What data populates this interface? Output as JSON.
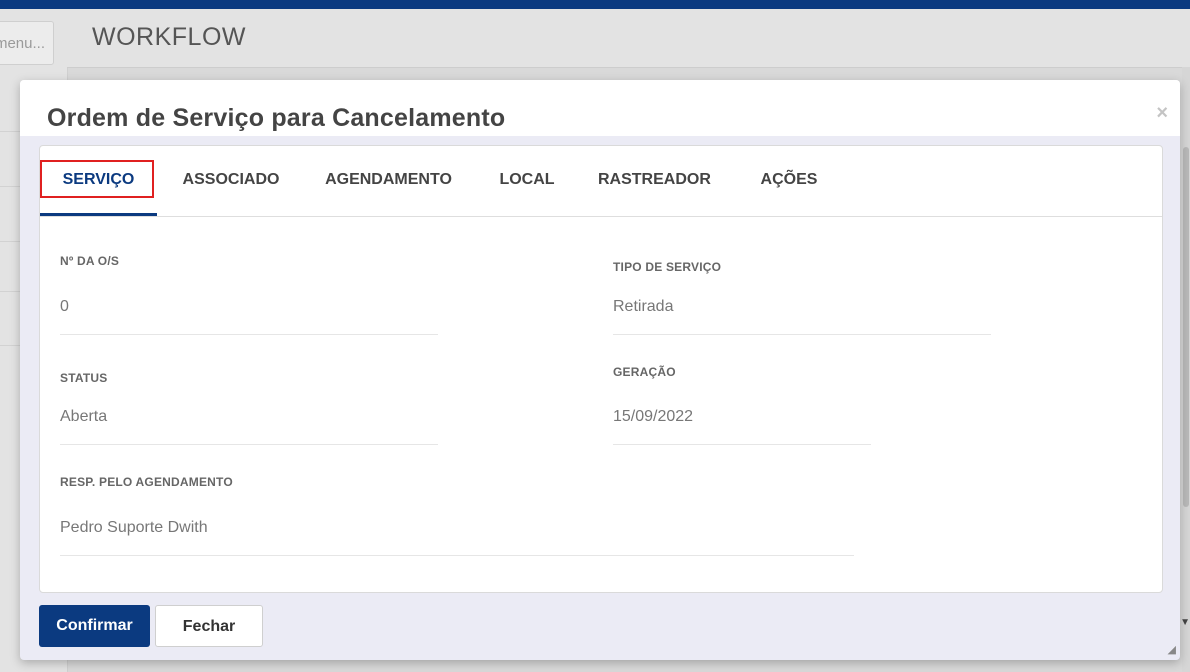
{
  "app": {
    "side_search_placeholder": "menu...",
    "page_title": "WORKFLOW"
  },
  "modal": {
    "title": "Ordem de Serviço para Cancelamento",
    "close_symbol": "×",
    "tabs": [
      {
        "label": "SERVIÇO",
        "active": true
      },
      {
        "label": "ASSOCIADO",
        "active": false
      },
      {
        "label": "AGENDAMENTO",
        "active": false
      },
      {
        "label": "LOCAL",
        "active": false
      },
      {
        "label": "RASTREADOR",
        "active": false
      },
      {
        "label": "AÇÕES",
        "active": false
      }
    ],
    "fields": {
      "os_number": {
        "label": "Nº DA O/S",
        "value": "0"
      },
      "service_type": {
        "label": "TIPO DE SERVIÇO",
        "value": "Retirada"
      },
      "status": {
        "label": "STATUS",
        "value": "Aberta"
      },
      "generation": {
        "label": "GERAÇÃO",
        "value": "15/09/2022"
      },
      "scheduler": {
        "label": "RESP. PELO AGENDAMENTO",
        "value": "Pedro Suporte Dwith"
      }
    },
    "buttons": {
      "confirm": "Confirmar",
      "close": "Fechar"
    }
  },
  "colors": {
    "brand": "#0b3a80",
    "highlight": "#e02020"
  }
}
